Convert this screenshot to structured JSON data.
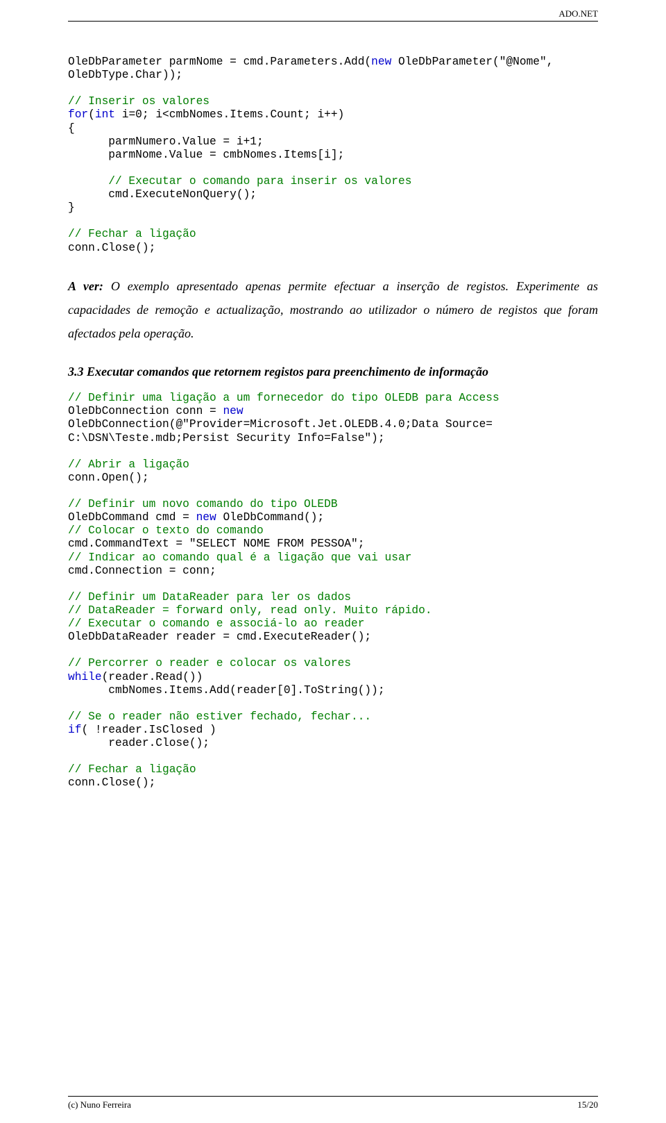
{
  "header": {
    "right": "ADO.NET"
  },
  "code1": {
    "l1a": "OleDbParameter parmNome = cmd.Parameters.Add(",
    "l1b": "new",
    "l1c": " OleDbParameter(",
    "l1d": "\"@Nome\"",
    "l1e": ",",
    "l2": "OleDbType.Char));",
    "l4c": "// Inserir os valores",
    "l5a": "for",
    "l5b": "(",
    "l5c": "int",
    "l5d": " i=0; i<cmbNomes.Items.Count; i++)",
    "l6": "{",
    "l7": "      parmNumero.Value = i+1;",
    "l8": "      parmNome.Value = cmbNomes.Items[i];",
    "l10c": "      // Executar o comando para inserir os valores",
    "l11": "      cmd.ExecuteNonQuery();",
    "l12": "}",
    "l14c": "// Fechar a ligação",
    "l15": "conn.Close();"
  },
  "aver": {
    "bold": "A ver:",
    "rest": " O exemplo apresentado apenas permite efectuar a inserção de registos. Experimente as capacidades de remoção e actualização, mostrando ao utilizador o número de registos que foram afectados pela operação."
  },
  "section": {
    "num": "3.3",
    "title": "   Executar comandos que retornem registos para preenchimento de informação"
  },
  "code2": {
    "l1c": "// Definir uma ligação a um fornecedor do tipo OLEDB para Access",
    "l2a": "OleDbConnection conn = ",
    "l2b": "new",
    "l3a": "OleDbConnection(",
    "l3b": "@\"Provider=Microsoft.Jet.OLEDB.4.0;Data Source=",
    "l4": "C:\\DSN\\Teste.mdb;Persist Security Info=False\");",
    "l6c": "// Abrir a ligação",
    "l7": "conn.Open();",
    "l9c": "// Definir um novo comando do tipo OLEDB",
    "l10a": "OleDbCommand cmd = ",
    "l10b": "new",
    "l10c": " OleDbCommand();",
    "l11c": "// Colocar o texto do comando",
    "l12a": "cmd.CommandText = ",
    "l12b": "\"SELECT NOME FROM PESSOA\"",
    "l12c": ";",
    "l13c": "// Indicar ao comando qual é a ligação que vai usar",
    "l14": "cmd.Connection = conn;",
    "l16c": "// Definir um DataReader para ler os dados",
    "l17c": "// DataReader = forward only, read only. Muito rápido.",
    "l18c": "// Executar o comando e associá-lo ao reader",
    "l19": "OleDbDataReader reader = cmd.ExecuteReader();",
    "l21c": "// Percorrer o reader e colocar os valores",
    "l22a": "while",
    "l22b": "(reader.Read())",
    "l23": "      cmbNomes.Items.Add(reader[0].ToString());",
    "l25c": "// Se o reader não estiver fechado, fechar...",
    "l26a": "if",
    "l26b": "( !reader.IsClosed )",
    "l27": "      reader.Close();",
    "l29c": "// Fechar a ligação",
    "l30": "conn.Close();"
  },
  "footer": {
    "left": "(c) Nuno Ferreira",
    "right": "15/20"
  }
}
